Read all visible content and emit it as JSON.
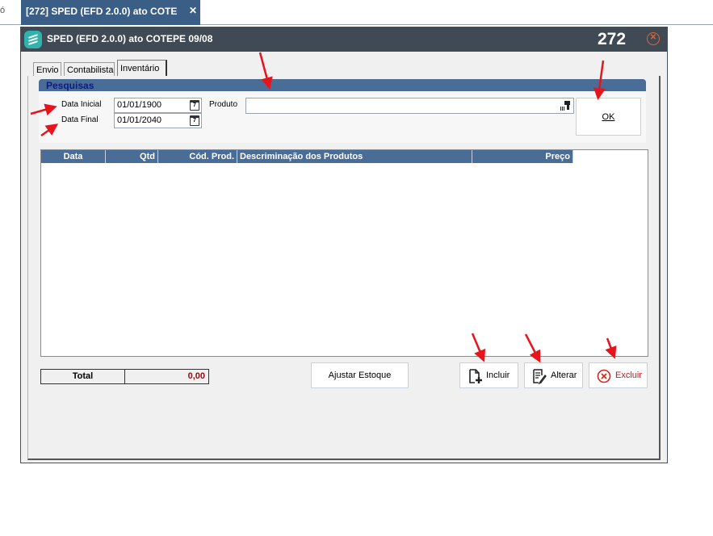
{
  "tabstrip": {
    "stub_text": "ó",
    "active_tab": "[272] SPED (EFD 2.0.0) ato COTE",
    "close_glyph": "✕"
  },
  "window": {
    "title": "SPED (EFD 2.0.0) ato COTEPE 09/08",
    "number": "272",
    "close_glyph": "✕"
  },
  "tabs": [
    {
      "label": "Envio"
    },
    {
      "label": "Contabilista"
    },
    {
      "label": "Inventário",
      "active": true
    }
  ],
  "search": {
    "group_title": "Pesquisas",
    "data_inicial_label": "Data Inicial",
    "data_inicial_value": "01/01/1900",
    "data_final_label": "Data Final",
    "data_final_value": "01/01/2040",
    "produto_label": "Produto",
    "produto_value": "",
    "ok_label": "OK",
    "calendar_glyph": "7"
  },
  "grid": {
    "columns": [
      "Data",
      "Qtd",
      "Cód. Prod.",
      "Descriminação dos Produtos",
      "Preço"
    ]
  },
  "totals": {
    "label": "Total",
    "value": "0,00"
  },
  "buttons": {
    "ajustar": "Ajustar Estoque",
    "incluir": "Incluir",
    "alterar": "Alterar",
    "excluir": "Excluir"
  },
  "colors": {
    "accent": "#4a6d98",
    "titlebar": "#3f4a55",
    "tab_active": "#3b5e87",
    "logo": "#31b2ac",
    "total_value": "#8a0d12",
    "annotation": "#e8141b"
  },
  "icons": {
    "logo": "app-logo-icon",
    "calendar": "calendar-icon",
    "barcode": "barcode-scanner-icon",
    "incluir": "add-document-icon",
    "alterar": "edit-document-icon",
    "excluir": "delete-circle-icon"
  }
}
